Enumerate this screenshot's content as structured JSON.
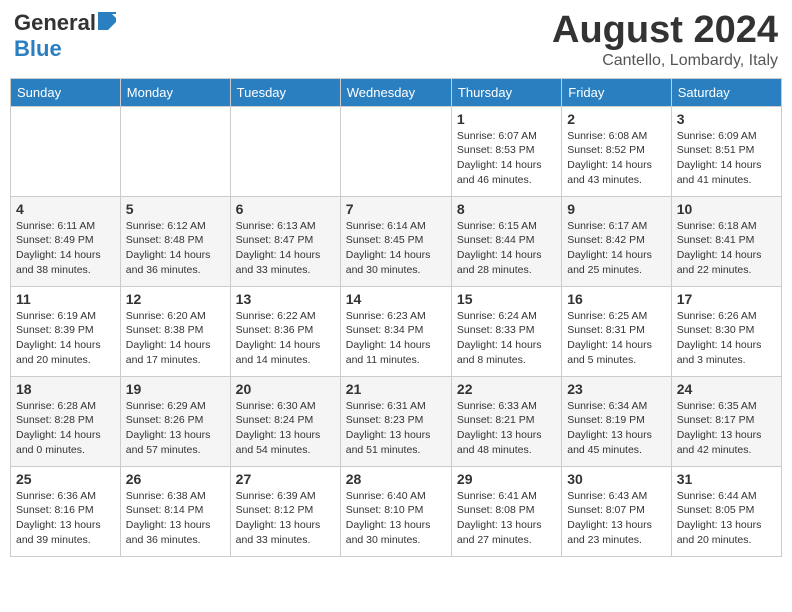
{
  "header": {
    "logo_general": "General",
    "logo_blue": "Blue",
    "month_year": "August 2024",
    "location": "Cantello, Lombardy, Italy"
  },
  "weekdays": [
    "Sunday",
    "Monday",
    "Tuesday",
    "Wednesday",
    "Thursday",
    "Friday",
    "Saturday"
  ],
  "weeks": [
    [
      {
        "day": "",
        "info": ""
      },
      {
        "day": "",
        "info": ""
      },
      {
        "day": "",
        "info": ""
      },
      {
        "day": "",
        "info": ""
      },
      {
        "day": "1",
        "info": "Sunrise: 6:07 AM\nSunset: 8:53 PM\nDaylight: 14 hours\nand 46 minutes."
      },
      {
        "day": "2",
        "info": "Sunrise: 6:08 AM\nSunset: 8:52 PM\nDaylight: 14 hours\nand 43 minutes."
      },
      {
        "day": "3",
        "info": "Sunrise: 6:09 AM\nSunset: 8:51 PM\nDaylight: 14 hours\nand 41 minutes."
      }
    ],
    [
      {
        "day": "4",
        "info": "Sunrise: 6:11 AM\nSunset: 8:49 PM\nDaylight: 14 hours\nand 38 minutes."
      },
      {
        "day": "5",
        "info": "Sunrise: 6:12 AM\nSunset: 8:48 PM\nDaylight: 14 hours\nand 36 minutes."
      },
      {
        "day": "6",
        "info": "Sunrise: 6:13 AM\nSunset: 8:47 PM\nDaylight: 14 hours\nand 33 minutes."
      },
      {
        "day": "7",
        "info": "Sunrise: 6:14 AM\nSunset: 8:45 PM\nDaylight: 14 hours\nand 30 minutes."
      },
      {
        "day": "8",
        "info": "Sunrise: 6:15 AM\nSunset: 8:44 PM\nDaylight: 14 hours\nand 28 minutes."
      },
      {
        "day": "9",
        "info": "Sunrise: 6:17 AM\nSunset: 8:42 PM\nDaylight: 14 hours\nand 25 minutes."
      },
      {
        "day": "10",
        "info": "Sunrise: 6:18 AM\nSunset: 8:41 PM\nDaylight: 14 hours\nand 22 minutes."
      }
    ],
    [
      {
        "day": "11",
        "info": "Sunrise: 6:19 AM\nSunset: 8:39 PM\nDaylight: 14 hours\nand 20 minutes."
      },
      {
        "day": "12",
        "info": "Sunrise: 6:20 AM\nSunset: 8:38 PM\nDaylight: 14 hours\nand 17 minutes."
      },
      {
        "day": "13",
        "info": "Sunrise: 6:22 AM\nSunset: 8:36 PM\nDaylight: 14 hours\nand 14 minutes."
      },
      {
        "day": "14",
        "info": "Sunrise: 6:23 AM\nSunset: 8:34 PM\nDaylight: 14 hours\nand 11 minutes."
      },
      {
        "day": "15",
        "info": "Sunrise: 6:24 AM\nSunset: 8:33 PM\nDaylight: 14 hours\nand 8 minutes."
      },
      {
        "day": "16",
        "info": "Sunrise: 6:25 AM\nSunset: 8:31 PM\nDaylight: 14 hours\nand 5 minutes."
      },
      {
        "day": "17",
        "info": "Sunrise: 6:26 AM\nSunset: 8:30 PM\nDaylight: 14 hours\nand 3 minutes."
      }
    ],
    [
      {
        "day": "18",
        "info": "Sunrise: 6:28 AM\nSunset: 8:28 PM\nDaylight: 14 hours\nand 0 minutes."
      },
      {
        "day": "19",
        "info": "Sunrise: 6:29 AM\nSunset: 8:26 PM\nDaylight: 13 hours\nand 57 minutes."
      },
      {
        "day": "20",
        "info": "Sunrise: 6:30 AM\nSunset: 8:24 PM\nDaylight: 13 hours\nand 54 minutes."
      },
      {
        "day": "21",
        "info": "Sunrise: 6:31 AM\nSunset: 8:23 PM\nDaylight: 13 hours\nand 51 minutes."
      },
      {
        "day": "22",
        "info": "Sunrise: 6:33 AM\nSunset: 8:21 PM\nDaylight: 13 hours\nand 48 minutes."
      },
      {
        "day": "23",
        "info": "Sunrise: 6:34 AM\nSunset: 8:19 PM\nDaylight: 13 hours\nand 45 minutes."
      },
      {
        "day": "24",
        "info": "Sunrise: 6:35 AM\nSunset: 8:17 PM\nDaylight: 13 hours\nand 42 minutes."
      }
    ],
    [
      {
        "day": "25",
        "info": "Sunrise: 6:36 AM\nSunset: 8:16 PM\nDaylight: 13 hours\nand 39 minutes."
      },
      {
        "day": "26",
        "info": "Sunrise: 6:38 AM\nSunset: 8:14 PM\nDaylight: 13 hours\nand 36 minutes."
      },
      {
        "day": "27",
        "info": "Sunrise: 6:39 AM\nSunset: 8:12 PM\nDaylight: 13 hours\nand 33 minutes."
      },
      {
        "day": "28",
        "info": "Sunrise: 6:40 AM\nSunset: 8:10 PM\nDaylight: 13 hours\nand 30 minutes."
      },
      {
        "day": "29",
        "info": "Sunrise: 6:41 AM\nSunset: 8:08 PM\nDaylight: 13 hours\nand 27 minutes."
      },
      {
        "day": "30",
        "info": "Sunrise: 6:43 AM\nSunset: 8:07 PM\nDaylight: 13 hours\nand 23 minutes."
      },
      {
        "day": "31",
        "info": "Sunrise: 6:44 AM\nSunset: 8:05 PM\nDaylight: 13 hours\nand 20 minutes."
      }
    ]
  ]
}
